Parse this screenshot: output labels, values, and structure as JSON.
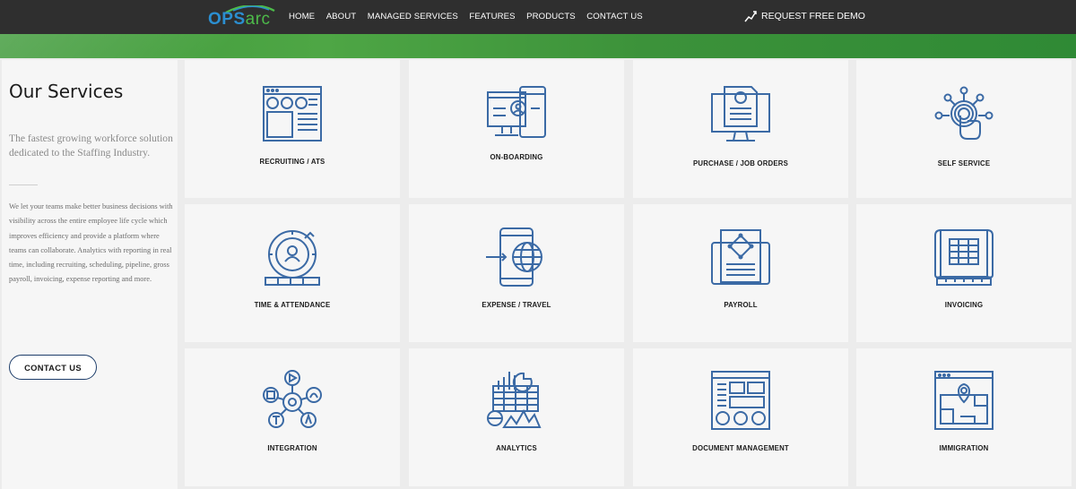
{
  "brand": {
    "logo_part1": "OPS",
    "logo_part2": "arc"
  },
  "nav": {
    "items": [
      "HOME",
      "ABOUT",
      "MANAGED SERVICES",
      "FEATURES",
      "PRODUCTS",
      "CONTACT US"
    ],
    "demo_label": "REQUEST FREE DEMO"
  },
  "sidebar": {
    "title": "Our Services",
    "subtitle": "The fastest growing workforce solution dedicated to the Staffing Industry.",
    "body": "We let your teams make better business decisions with visibility across the entire employee life cycle which improves efficiency and provide a platform where teams can collaborate. Analytics with reporting in real time, including recruiting, scheduling, pipeline, gross payroll, invoicing, expense reporting and more.",
    "button": "CONTACT US"
  },
  "services": [
    {
      "label": "RECRUITING / ATS",
      "icon": "recruiting-icon"
    },
    {
      "label": "ON-BOARDING",
      "icon": "onboarding-icon"
    },
    {
      "label": "PURCHASE / JOB ORDERS",
      "icon": "purchase-orders-icon"
    },
    {
      "label": "SELF SERVICE",
      "icon": "self-service-icon"
    },
    {
      "label": "TIME & ATTENDANCE",
      "icon": "time-attendance-icon"
    },
    {
      "label": "EXPENSE / TRAVEL",
      "icon": "expense-travel-icon"
    },
    {
      "label": "PAYROLL",
      "icon": "payroll-icon"
    },
    {
      "label": "INVOICING",
      "icon": "invoicing-icon"
    },
    {
      "label": "INTEGRATION",
      "icon": "integration-icon"
    },
    {
      "label": "ANALYTICS",
      "icon": "analytics-icon"
    },
    {
      "label": "DOCUMENT MANAGEMENT",
      "icon": "document-management-icon"
    },
    {
      "label": "IMMIGRATION",
      "icon": "immigration-icon"
    }
  ],
  "colors": {
    "icon_blue": "#3b6aa5",
    "nav_bg": "#2f2f2f",
    "accent_green": "#4ea645"
  }
}
